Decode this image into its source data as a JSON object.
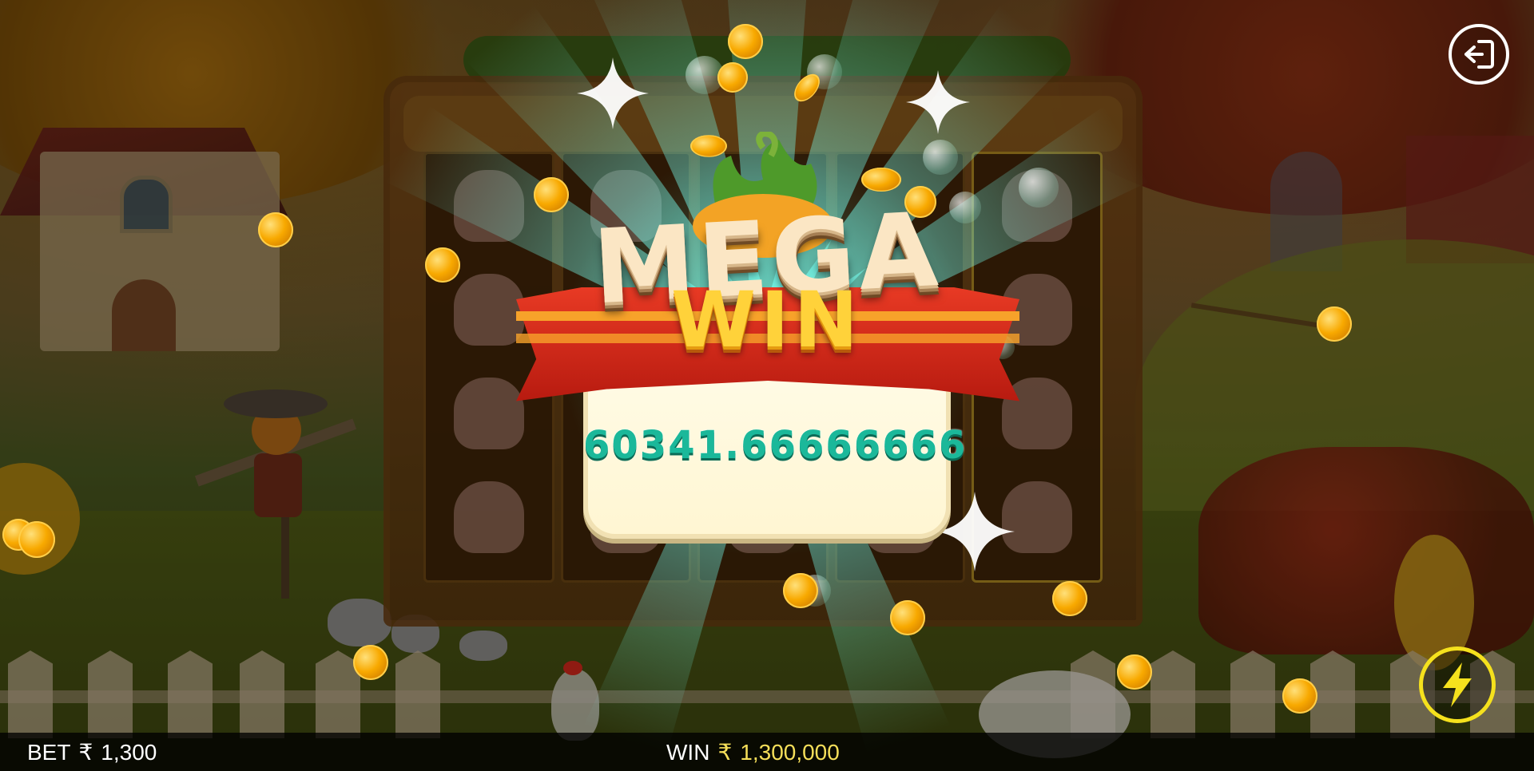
{
  "hud": {
    "bet_label": "BET",
    "bet_currency": "₹",
    "bet_value": "1,300",
    "win_label": "WIN",
    "win_currency": "₹",
    "win_value": "1,300,000"
  },
  "popup": {
    "line1": "MEGA",
    "line2": "WIN",
    "amount": "60341.66666666"
  },
  "buttons": {
    "exit_icon": "exit-icon",
    "turbo_icon": "lightning-bolt-icon"
  },
  "colors": {
    "win_value": "#f6df5a",
    "amount_text": "#1bb89a",
    "turbo_ring": "#f5e11d",
    "ribbon": "#e83a24"
  }
}
